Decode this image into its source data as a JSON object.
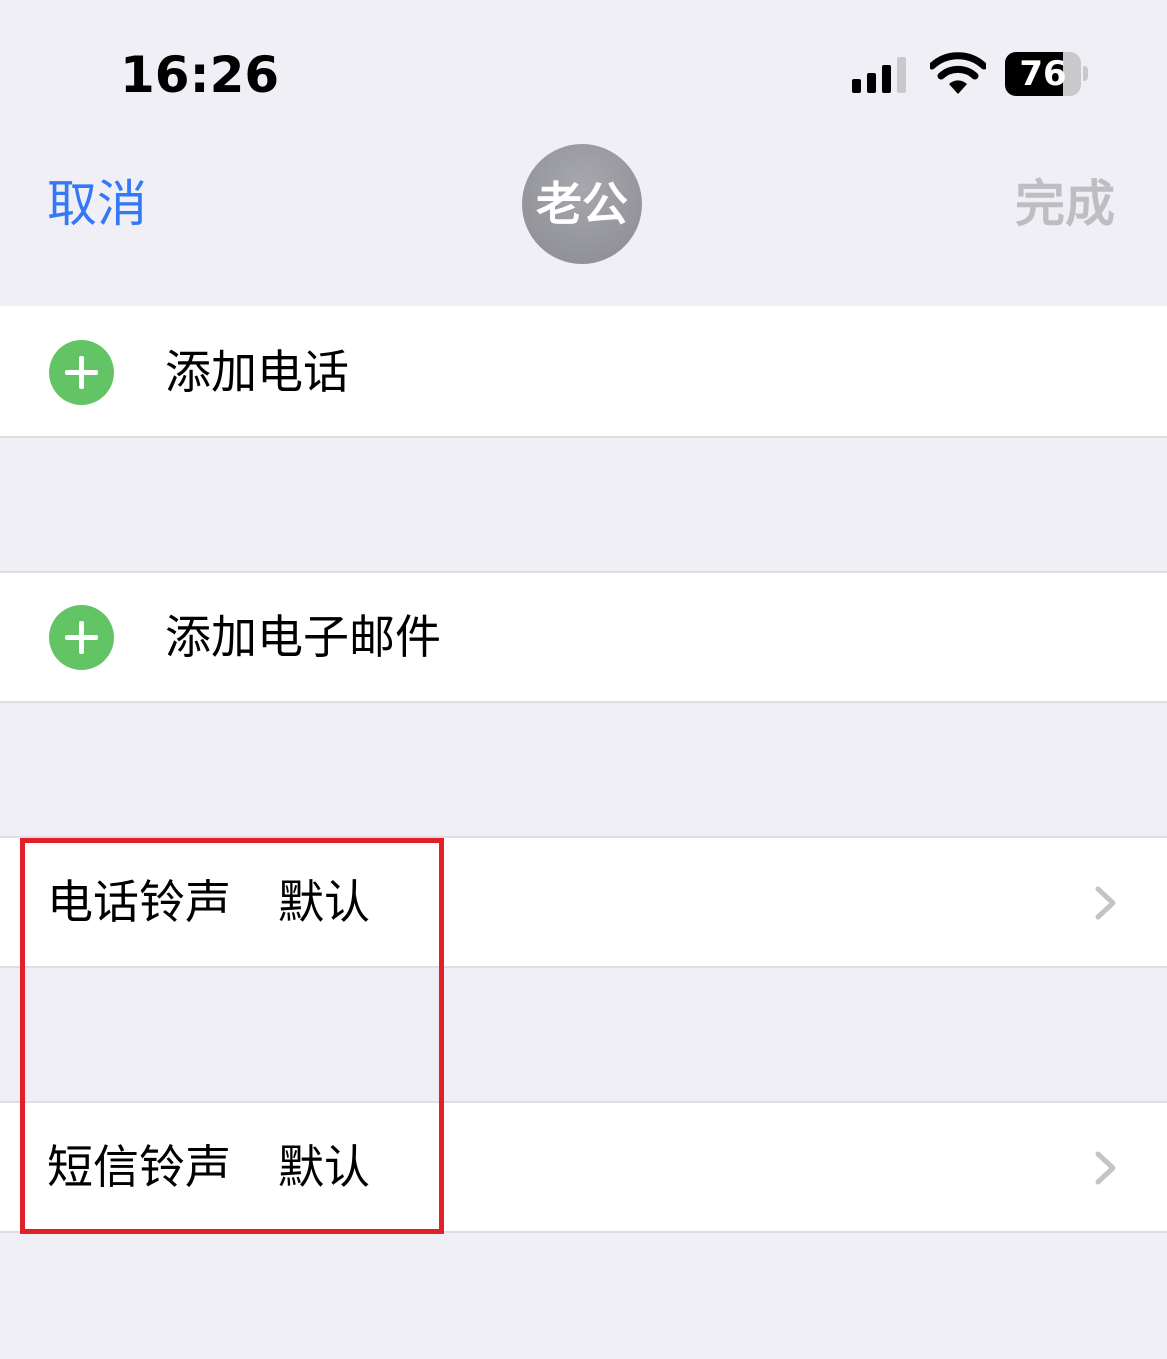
{
  "status_bar": {
    "time": "16:26",
    "battery_percent": "76",
    "battery_level": 0.76,
    "signal_bars": 3,
    "icons": [
      "signal-icon",
      "wifi-icon",
      "battery-icon"
    ]
  },
  "nav": {
    "cancel_label": "取消",
    "avatar_text": "老公",
    "done_label": "完成"
  },
  "add_phone": {
    "label": "添加电话",
    "icon": "add-circle-icon"
  },
  "add_email": {
    "label": "添加电子邮件",
    "icon": "add-circle-icon"
  },
  "ringtone": {
    "label": "电话铃声",
    "value": "默认",
    "icon": "chevron-right-icon"
  },
  "text_tone": {
    "label": "短信铃声",
    "value": "默认",
    "icon": "chevron-right-icon"
  },
  "colors": {
    "accent": "#3478f6",
    "add_green": "#63c466",
    "highlight_red": "#e1202a",
    "background": "#f0eff5"
  }
}
